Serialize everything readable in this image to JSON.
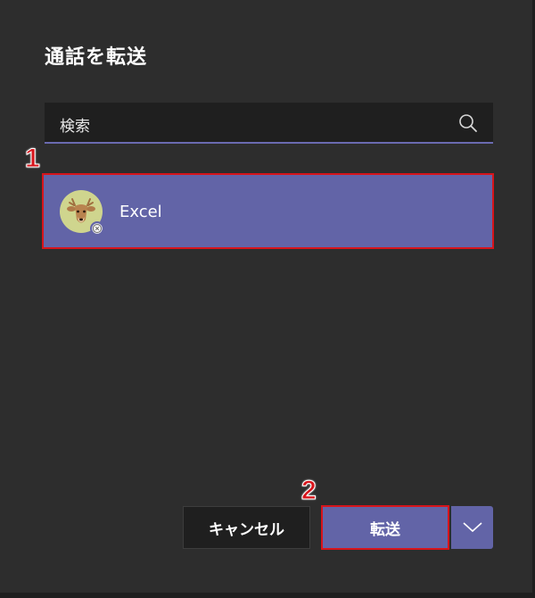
{
  "dialog": {
    "title": "通話を転送"
  },
  "search": {
    "value": "検索",
    "icon": "search-icon"
  },
  "annotations": {
    "marker_1": "1",
    "marker_2": "2",
    "highlight_color": "#d7141b"
  },
  "results": [
    {
      "name": "Excel",
      "avatar": "deer-avatar",
      "status_icon": "status-unavailable-icon"
    }
  ],
  "footer": {
    "cancel_label": "キャンセル",
    "transfer_label": "転送",
    "dropdown_icon": "chevron-down-icon"
  },
  "colors": {
    "background": "#2d2d2d",
    "accent": "#6264a7",
    "input_background": "#1f1f1f"
  }
}
